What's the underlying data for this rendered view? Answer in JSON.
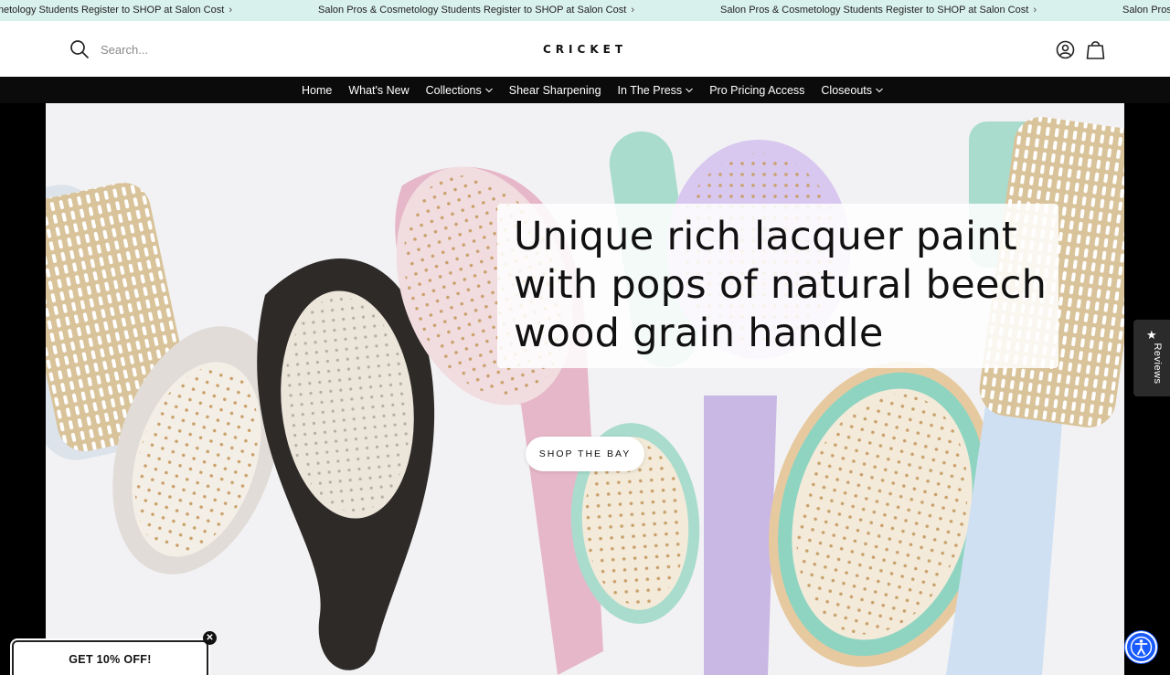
{
  "announcement": {
    "items": [
      "Salon Pros & Cosmetology Students Register to SHOP at Salon Cost",
      "Salon Pros & Cosmetology Students Register to SHOP at Salon Cost",
      "Salon Pros & Cosmetology Students Register to SHOP at Salon Cost",
      "Salon Pros & Cosmetology Students Register to SHOP at Salon Cost"
    ],
    "background": "#d9f1ec"
  },
  "header": {
    "search_placeholder": "Search...",
    "logo": "CRICKET"
  },
  "nav": {
    "items": [
      {
        "label": "Home",
        "dropdown": false
      },
      {
        "label": "What's New",
        "dropdown": false
      },
      {
        "label": "Collections",
        "dropdown": true
      },
      {
        "label": "Shear Sharpening",
        "dropdown": false
      },
      {
        "label": "In The Press",
        "dropdown": true
      },
      {
        "label": "Pro Pricing Access",
        "dropdown": false
      },
      {
        "label": "Closeouts",
        "dropdown": true
      }
    ]
  },
  "hero": {
    "headline": "Unique rich lacquer paint with pops of natural beech wood grain handle",
    "cta_label": "SHOP THE BAY"
  },
  "reviews_tab": {
    "label": "Reviews",
    "icon": "star-icon"
  },
  "promo": {
    "label": "GET 10% OFF!"
  },
  "accessibility": {
    "icon": "accessibility-icon",
    "color": "#1a5bff"
  }
}
